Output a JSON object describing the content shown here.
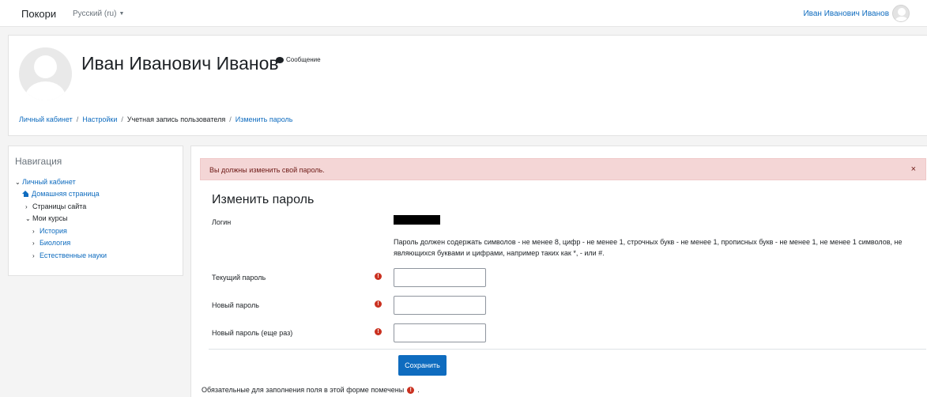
{
  "topbar": {
    "site_name": "Покори",
    "language": "Русский (ru)",
    "language_caret": "▼",
    "user_name": "Иван Иванович Иванов"
  },
  "header": {
    "fullname": "Иван Иванович Иванов",
    "message_label": "Сообщение",
    "breadcrumb": [
      "Личный кабинет",
      "Настройки",
      "Учетная запись пользователя",
      "Изменить пароль"
    ],
    "breadcrumb_sep": "/"
  },
  "navigation": {
    "title": "Навигация",
    "items": [
      {
        "label": "Личный кабинет",
        "chev": "⌄"
      },
      {
        "label": "Домашняя страница"
      },
      {
        "label": "Страницы сайта",
        "chev": "›"
      },
      {
        "label": "Мои курсы",
        "chev": "⌄"
      },
      {
        "label": "История",
        "chev": "›"
      },
      {
        "label": "Биология",
        "chev": "›"
      },
      {
        "label": "Естественные науки",
        "chev": "›"
      }
    ]
  },
  "alert": {
    "text": "Вы должны изменить свой пароль.",
    "close": "×"
  },
  "form": {
    "title": "Изменить пароль",
    "login_label": "Логин",
    "password_rules": "Пароль должен содержать символов - не менее 8, цифр - не менее 1, строчных букв - не менее 1, прописных букв - не менее 1, не менее 1 символов, не являющихся буквами и цифрами, например таких как *, - или #.",
    "fields": [
      {
        "label": "Текущий пароль",
        "value": ""
      },
      {
        "label": "Новый пароль",
        "value": ""
      },
      {
        "label": "Новый пароль (еще раз)",
        "value": ""
      }
    ],
    "required_icon": "!",
    "save_label": "Сохранить",
    "required_note_before": "Обязательные для заполнения поля в этой форме помечены",
    "required_note_after": "."
  },
  "colors": {
    "accent": "#0f6cbf",
    "alert_bg": "#f4d6d6",
    "required": "#ca3120"
  }
}
